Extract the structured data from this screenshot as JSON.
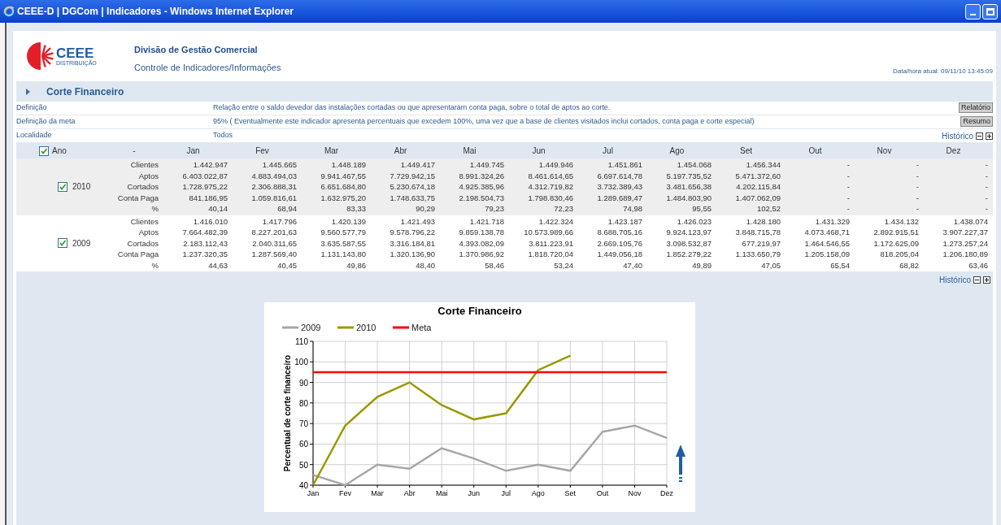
{
  "window": {
    "title": "CEEE-D | DGCom | Indicadores - Windows Internet Explorer"
  },
  "header": {
    "logo_text": "CEEE",
    "logo_subtext": "DISTRIBUIÇÃO",
    "division": "Divisão de Gestão Comercial",
    "subtitle": "Controle de Indicadores/Informações",
    "datetime": "Data/hora atual: 09/11/10 13:45:09"
  },
  "section": {
    "title": "Corte Financeiro",
    "expanded": false
  },
  "info_rows": [
    {
      "label": "Definição",
      "value": "Relação entre o saldo devedor das instalações cortadas ou que apresentaram conta paga, sobre o total de aptos ao corte.",
      "button": "Relatório"
    },
    {
      "label": "Definição da meta",
      "value": "95% ( Eventualmente este indicador apresenta percentuais que excedem 100%, uma vez que a base de clientes visitados inclui cortados, conta paga e corte especial)",
      "button": "Resumo"
    },
    {
      "label": "Localidade",
      "value": "Todos",
      "link": "Histórico"
    }
  ],
  "table": {
    "year_header": "Ano",
    "year_header_checked": true,
    "label_header": "-",
    "months": [
      "Jan",
      "Fev",
      "Mar",
      "Abr",
      "Mai",
      "Jun",
      "Jul",
      "Ago",
      "Set",
      "Out",
      "Nov",
      "Dez"
    ],
    "groups": [
      {
        "year": "2010",
        "checked": true,
        "rows": [
          {
            "label": "Clientes",
            "values": [
              "1.442.947",
              "1.445.665",
              "1.448.189",
              "1.449.417",
              "1.449.745",
              "1.449.946",
              "1.451.861",
              "1.454.068",
              "1.456.344",
              "-",
              "-",
              "-"
            ]
          },
          {
            "label": "Aptos",
            "values": [
              "6.403.022,87",
              "4.883.494,03",
              "9.941.467,55",
              "7.729.942,15",
              "8.991.324,26",
              "8.461.614,65",
              "6.697.614,78",
              "5.197.735,52",
              "5.471.372,60",
              "-",
              "-",
              "-"
            ]
          },
          {
            "label": "Cortados",
            "values": [
              "1.728.975,22",
              "2.306.888,31",
              "6.651.684,80",
              "5.230.674,18",
              "4.925.385,96",
              "4.312.719,82",
              "3.732.389,43",
              "3.481.656,38",
              "4.202.115,84",
              "-",
              "-",
              "-"
            ]
          },
          {
            "label": "Conta Paga",
            "values": [
              "841.186,95",
              "1.059.816,61",
              "1.632.975,20",
              "1.748.633,75",
              "2.198.504,73",
              "1.798.830,46",
              "1.289.689,47",
              "1.484.803,90",
              "1.407.062,09",
              "-",
              "-",
              "-"
            ]
          },
          {
            "label": "%",
            "values": [
              "40,14",
              "68,94",
              "83,33",
              "90,29",
              "79,23",
              "72,23",
              "74,98",
              "95,55",
              "102,52",
              "-",
              "-",
              "-"
            ]
          }
        ]
      },
      {
        "year": "2009",
        "checked": true,
        "rows": [
          {
            "label": "Clientes",
            "values": [
              "1.416.010",
              "1.417.796",
              "1.420.139",
              "1.421.493",
              "1.421.718",
              "1.422.324",
              "1.423.187",
              "1.426.023",
              "1.428.180",
              "1.431.329",
              "1.434.132",
              "1.438.074"
            ]
          },
          {
            "label": "Aptos",
            "values": [
              "7.664.482,39",
              "8.227.201,63",
              "9.560.577,79",
              "9.578.796,22",
              "9.859.138,78",
              "10.573.989,66",
              "8.688.705,16",
              "9.924.123,97",
              "3.848.715,78",
              "4.073.468,71",
              "2.892.915,51",
              "3.907.227,37"
            ]
          },
          {
            "label": "Cortados",
            "values": [
              "2.183.112,43",
              "2.040.311,65",
              "3.635.587,55",
              "3.316.184,81",
              "4.393.082,09",
              "3.811.223,91",
              "2.669.105,76",
              "3.098.532,87",
              "677.219,97",
              "1.464.546,55",
              "1.172.625,09",
              "1.273.257,24"
            ]
          },
          {
            "label": "Conta Paga",
            "values": [
              "1.237.320,35",
              "1.287.569,40",
              "1.131.143,80",
              "1.320.136,90",
              "1.370.986,92",
              "1.818.720,04",
              "1.449.056,18",
              "1.852.279,22",
              "1.133.650,79",
              "1.205.158,09",
              "818.205,04",
              "1.206.180,89"
            ]
          },
          {
            "label": "%",
            "values": [
              "44,63",
              "40,45",
              "49,86",
              "48,40",
              "58,46",
              "53,24",
              "47,40",
              "49,89",
              "47,05",
              "65,54",
              "68,82",
              "63,46"
            ]
          }
        ]
      }
    ]
  },
  "history_link": "Histórico",
  "chart": {
    "chart_data": {
      "type": "line",
      "title": "Corte Financeiro",
      "ylabel": "Percentual de corte financeiro",
      "categories": [
        "Jan",
        "Fev",
        "Mar",
        "Abr",
        "Mai",
        "Jun",
        "Jul",
        "Ago",
        "Set",
        "Out",
        "Nov",
        "Dez"
      ],
      "ylim": [
        40,
        110
      ],
      "grid": true,
      "legend": true,
      "yticks": [
        40,
        50,
        60,
        70,
        80,
        90,
        100,
        110
      ],
      "series": [
        {
          "name": "2009",
          "color": "#a6a6a6",
          "values": [
            45,
            40,
            50,
            48,
            58,
            53,
            47,
            50,
            47,
            66,
            69,
            63
          ]
        },
        {
          "name": "2010",
          "color": "#999900",
          "values": [
            40,
            69,
            83,
            90,
            79,
            72,
            75,
            96,
            103,
            null,
            null,
            null
          ]
        },
        {
          "name": "Meta",
          "color": "#ff0000",
          "values": [
            95,
            95,
            95,
            95,
            95,
            95,
            95,
            95,
            95,
            95,
            95,
            95
          ]
        }
      ]
    }
  }
}
